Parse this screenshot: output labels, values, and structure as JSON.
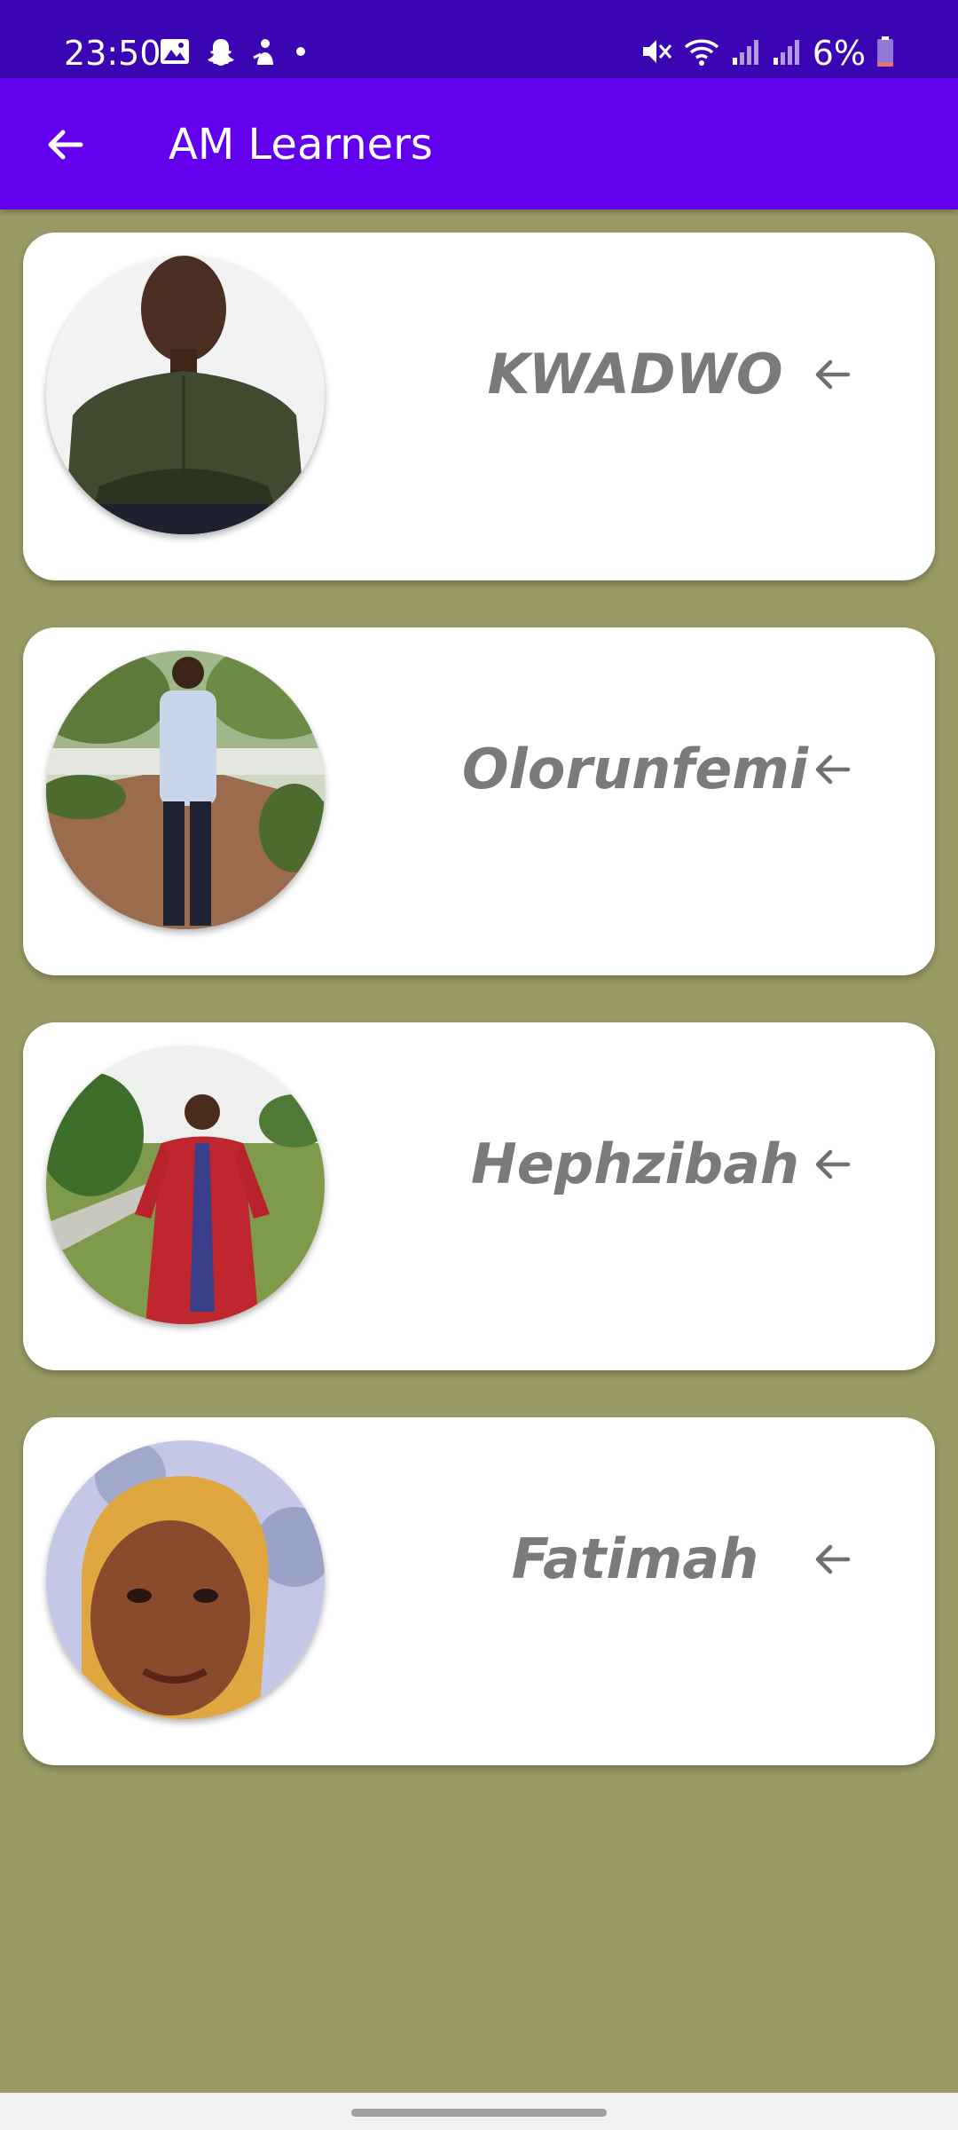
{
  "status_bar": {
    "time": "23:50",
    "battery": "6%",
    "left_icons": [
      "gallery-icon",
      "snapchat-icon",
      "notification-app-icon",
      "dot-icon"
    ],
    "right_icons": [
      "mute-icon",
      "wifi-icon",
      "signal-icon",
      "signal-icon",
      "battery-icon"
    ],
    "colors": {
      "background": "#3a06b4",
      "battery_low": "#e57373"
    }
  },
  "app_bar": {
    "title": "AM Learners",
    "back_icon": "arrow-back-icon",
    "color": "#6200ee"
  },
  "learners": [
    {
      "name": "KWADWO",
      "action_icon": "arrow-left-icon"
    },
    {
      "name": "Olorunfemi",
      "action_icon": "arrow-left-icon"
    },
    {
      "name": "Hephzibah",
      "action_icon": "arrow-left-icon"
    },
    {
      "name": "Fatimah",
      "action_icon": "arrow-left-icon"
    }
  ],
  "theme": {
    "page_background": "#9a9a64",
    "card_background": "#ffffff",
    "name_color": "#7a7a7a"
  }
}
